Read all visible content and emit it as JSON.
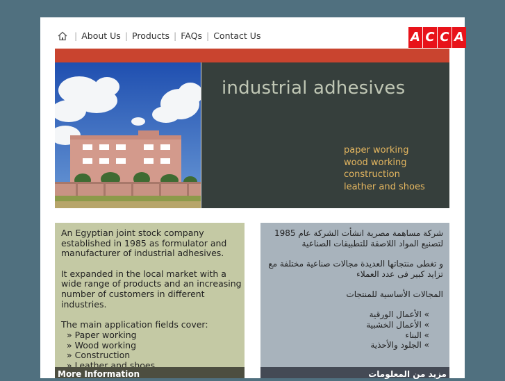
{
  "nav": {
    "home_icon": "home-icon",
    "items": [
      "About Us",
      "Products",
      "FAQs",
      "Contact Us"
    ]
  },
  "logo": {
    "letters": [
      "A",
      "C",
      "C",
      "A"
    ]
  },
  "hero": {
    "title": "industrial adhesives",
    "list": [
      "paper working",
      "wood working",
      "construction",
      "leather and shoes"
    ]
  },
  "left": {
    "p1": "An Egyptian joint stock company established in 1985 as formulator and manufacturer of industrial adhesives.",
    "p2": "It expanded in the local market with a wide range of products and an increasing number of customers in different industries.",
    "p3": "The main application fields cover:",
    "items": [
      "» Paper working",
      "» Wood working",
      "» Construction",
      "» Leather and shoes"
    ],
    "more": "More Information"
  },
  "right": {
    "p1": "شركة مساهمة مصرية انشأت الشركة عام 1985 لتصنيع المواد اللاصقة للتطبيقات الصناعية",
    "p2": "و تغطى منتجاتها العديدة مجالات صناعية مختلفة مع تزايد كبير فى عدد العملاء",
    "p3": "المجالات الأساسية للمنتجات",
    "items": [
      "»   الأعمال الورقية",
      "»   الأعمال الخشبية",
      "»   البناء",
      "»   الجلود والأحذية"
    ],
    "more": "مزيد من المعلومات"
  },
  "colors": {
    "background": "#50707f",
    "red_bar": "#c9442f",
    "hero_text_bg": "#363f3c",
    "hero_title": "#bfc6b4",
    "hero_list": "#e5b760",
    "left_col": "#c4c9a4",
    "right_col": "#a8b3bc",
    "logo": "#e8131a"
  }
}
